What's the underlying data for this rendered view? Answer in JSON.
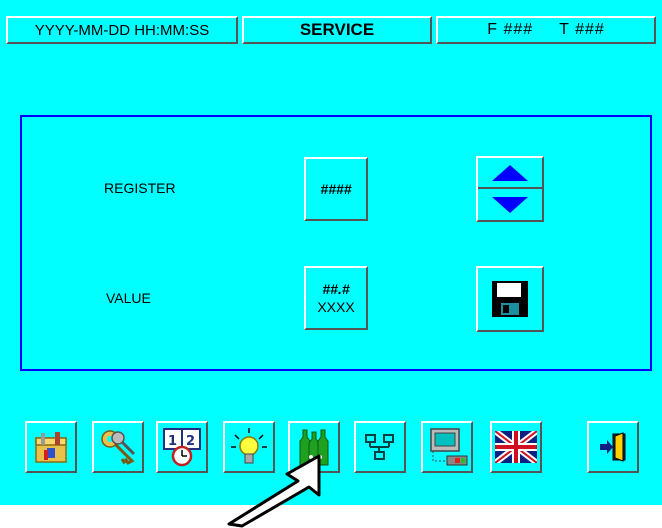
{
  "header": {
    "datetime": "YYYY-MM-DD HH:MM:SS",
    "title": "SERVICE",
    "f_value": "F ###",
    "t_value": "T ###"
  },
  "panel": {
    "register_label": "REGISTER",
    "register_value": "####",
    "value_label": "VALUE",
    "value_line1": "##.#",
    "value_line2": "XXXX"
  },
  "icons": {
    "up": "arrow-up-icon",
    "down": "arrow-down-icon",
    "save": "floppy-disk-icon"
  },
  "toolbar": [
    {
      "icon": "toolbox-icon"
    },
    {
      "icon": "keys-icon"
    },
    {
      "icon": "calendar-clock-icon"
    },
    {
      "icon": "light-bulb-icon"
    },
    {
      "icon": "bottles-icon"
    },
    {
      "icon": "network-icon"
    },
    {
      "icon": "computer-terminal-icon"
    },
    {
      "icon": "uk-flag-icon"
    },
    {
      "icon": "exit-door-icon"
    }
  ],
  "colors": {
    "background": "#00FFFF",
    "panel_border": "#0000FF",
    "arrow": "#0000FF"
  }
}
